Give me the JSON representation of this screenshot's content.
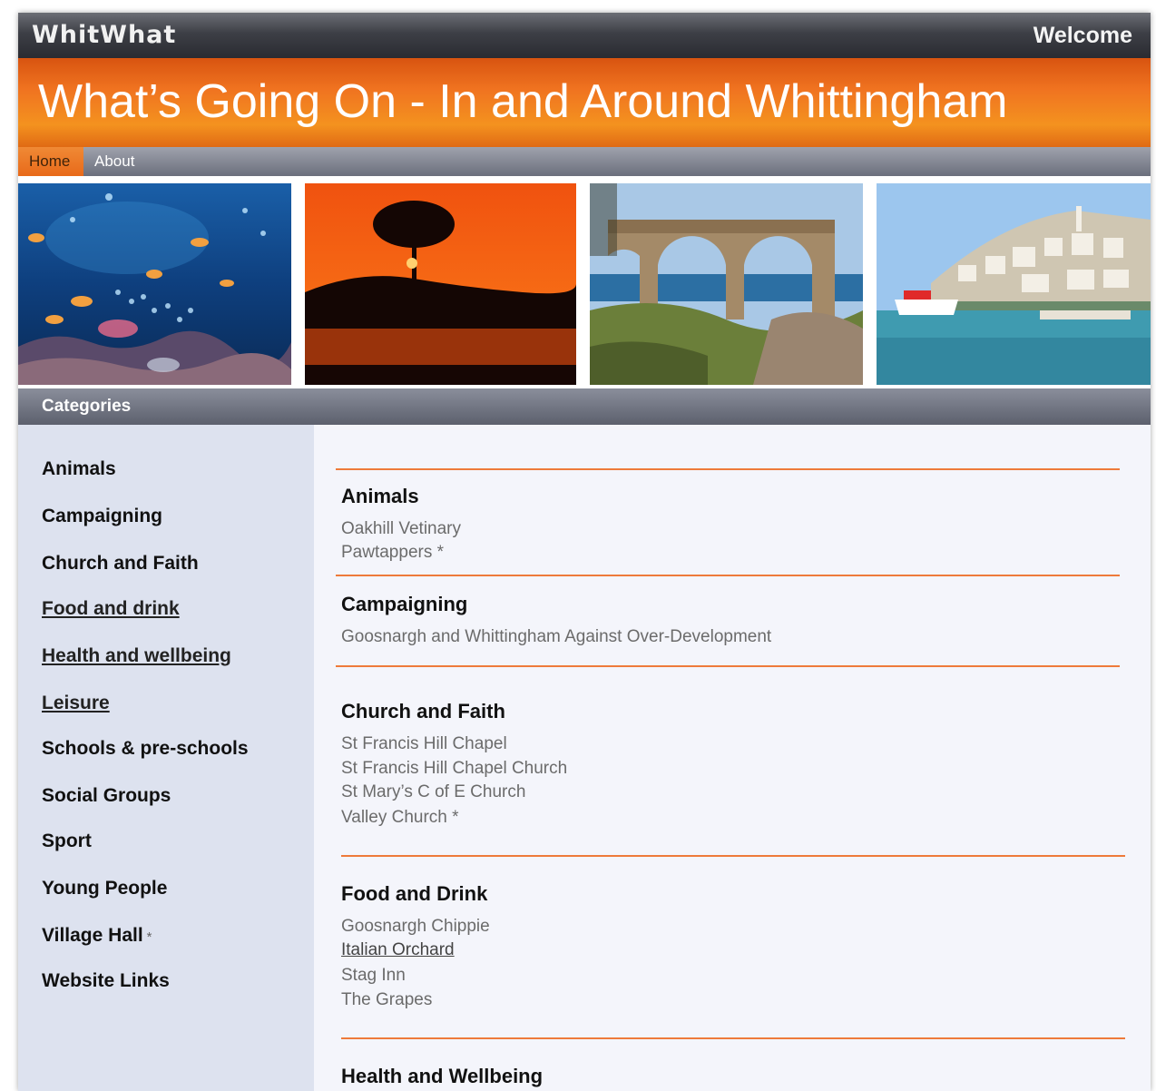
{
  "header": {
    "brand": "WhitWhat",
    "welcome": "Welcome"
  },
  "banner": {
    "title": "What’s Going On - In and Around Whittingham"
  },
  "nav": {
    "items": [
      {
        "label": "Home"
      },
      {
        "label": "About"
      }
    ]
  },
  "categories_bar": {
    "label": "Categories"
  },
  "sidebar": {
    "items": [
      {
        "label": "Animals"
      },
      {
        "label": "Campaigning"
      },
      {
        "label": "Church and Faith"
      },
      {
        "label": "Food and drink"
      },
      {
        "label": "Health and wellbeing"
      },
      {
        "label": "Leisure"
      },
      {
        "label": "Schools & pre-schools"
      },
      {
        "label": "Social Groups"
      },
      {
        "label": "Sport"
      },
      {
        "label": "Young People"
      },
      {
        "label": "Village Hall",
        "marker": "*"
      },
      {
        "label": "Website Links"
      }
    ]
  },
  "sections": [
    {
      "title": "Animals",
      "entries": [
        "Oakhill Vetinary",
        "Pawtappers *"
      ]
    },
    {
      "title": "Campaigning",
      "entries": [
        "Goosnargh and Whittingham Against Over-Development"
      ]
    },
    {
      "title": "Church and Faith",
      "entries": [
        "St Francis Hill Chapel",
        "St Francis Hill Chapel Church",
        "St Mary’s C of E Church",
        "Valley Church *"
      ]
    },
    {
      "title": "Food and Drink",
      "entries": [
        "Goosnargh Chippie",
        "Italian Orchard",
        "Stag Inn",
        "The Grapes"
      ]
    },
    {
      "title": "Health and Wellbeing",
      "entries": []
    }
  ],
  "photos": [
    {
      "subject": "underwater reef with fish"
    },
    {
      "subject": "orange sunset with tree silhouette"
    },
    {
      "subject": "ruined stone arches by the sea"
    },
    {
      "subject": "harbour town with boats"
    }
  ],
  "colors": {
    "accent": "#f07320",
    "sidebar_bg": "#dde2ef",
    "rule": "#ee7a3a"
  }
}
